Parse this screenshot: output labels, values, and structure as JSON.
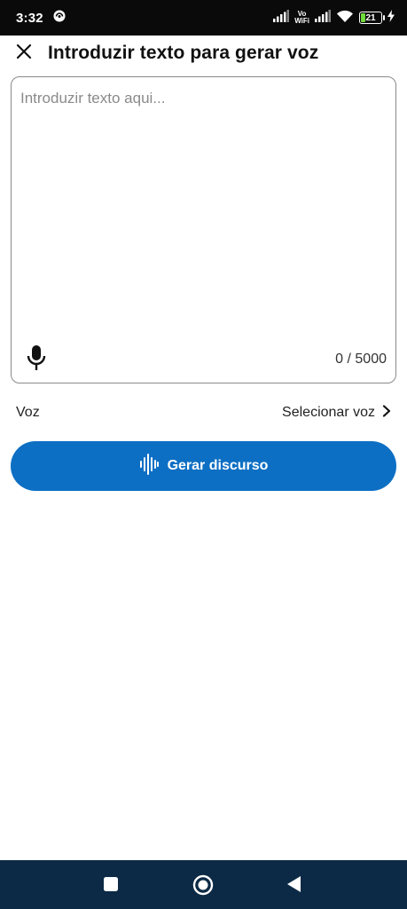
{
  "status_bar": {
    "time": "3:32",
    "network_label_top": "Vo",
    "network_label_bottom": "WiFi",
    "battery_level": "21"
  },
  "header": {
    "title": "Introduzir texto para gerar voz"
  },
  "text_input": {
    "placeholder": "Introduzir texto aqui...",
    "value": "",
    "counter": "0 / 5000"
  },
  "voice": {
    "label": "Voz",
    "select_label": "Selecionar voz"
  },
  "generate_button": {
    "label": "Gerar discurso"
  },
  "colors": {
    "accent": "#0d6fc4",
    "status_bar": "#0a0a0a",
    "nav_bar": "#0c2a45",
    "battery_fill": "#6fdc3b"
  },
  "icons": [
    "close-icon",
    "microphone-icon",
    "chevron-right-icon",
    "sound-wave-icon",
    "square-icon",
    "circle-home-icon",
    "triangle-back-icon"
  ]
}
